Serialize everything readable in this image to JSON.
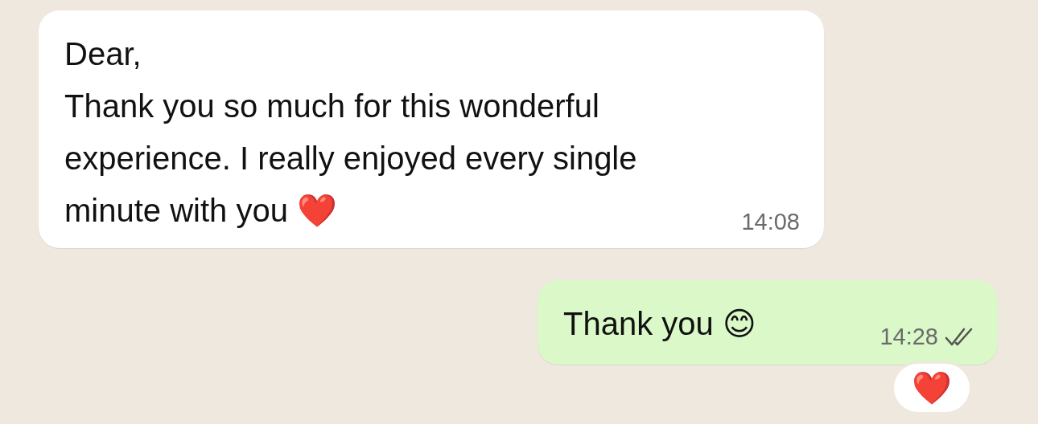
{
  "messages": [
    {
      "kind": "incoming",
      "text": "Dear,\nThank you so much for this wonderful experience. I really enjoyed every single minute with you ❤️",
      "time": "14:08"
    },
    {
      "kind": "outgoing",
      "text": "Thank you 😊",
      "time": "14:28",
      "read": false,
      "reaction": "❤️"
    }
  ]
}
